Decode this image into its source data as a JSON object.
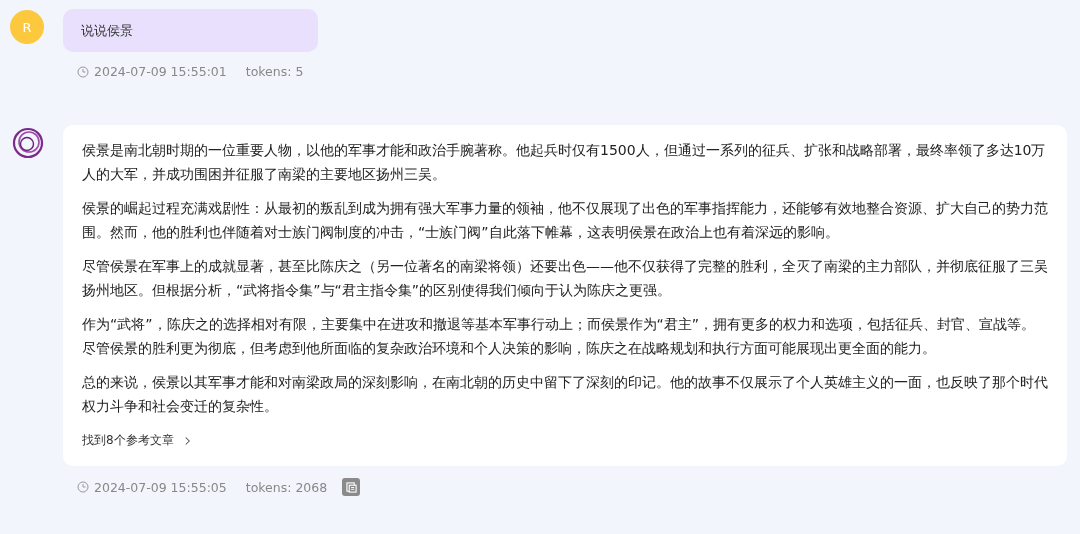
{
  "messages": [
    {
      "kind": "user",
      "avatar": "R",
      "paragraphs": [
        "说说侯景"
      ],
      "time": "2024-07-09 15:55:01",
      "tokens": "tokens: 5"
    },
    {
      "kind": "assistant",
      "paragraphs": [
        "侯景是南北朝时期的一位重要人物，以他的军事才能和政治手腕著称。他起兵时仅有1500人，但通过一系列的征兵、扩张和战略部署，最终率领了多达10万人的大军，并成功围困并征服了南梁的主要地区扬州三吴。",
        "侯景的崛起过程充满戏剧性：从最初的叛乱到成为拥有强大军事力量的领袖，他不仅展现了出色的军事指挥能力，还能够有效地整合资源、扩大自己的势力范围。然而，他的胜利也伴随着对士族门阀制度的冲击，“士族门阀”自此落下帷幕，这表明侯景在政治上也有着深远的影响。",
        "尽管侯景在军事上的成就显著，甚至比陈庆之（另一位著名的南梁将领）还要出色——他不仅获得了完整的胜利，全灭了南梁的主力部队，并彻底征服了三吴扬州地区。但根据分析，“武将指令集”与“君主指令集”的区别使得我们倾向于认为陈庆之更强。",
        "作为“武将”，陈庆之的选择相对有限，主要集中在进攻和撤退等基本军事行动上；而侯景作为“君主”，拥有更多的权力和选项，包括征兵、封官、宣战等。尽管侯景的胜利更为彻底，但考虑到他所面临的复杂政治环境和个人决策的影响，陈庆之在战略规划和执行方面可能展现出更全面的能力。",
        "总的来说，侯景以其军事才能和对南梁政局的深刻影响，在南北朝的历史中留下了深刻的印记。他的故事不仅展示了个人英雄主义的一面，也反映了那个时代权力斗争和社会变迁的复杂性。"
      ],
      "references": "找到8个参考文章",
      "time": "2024-07-09 15:55:05",
      "tokens": "tokens: 2068"
    }
  ]
}
